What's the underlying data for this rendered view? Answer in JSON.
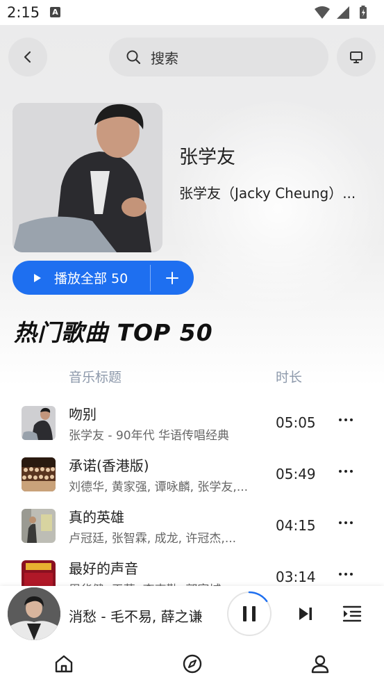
{
  "status_bar": {
    "time": "2:15",
    "notification_letter": "A"
  },
  "search": {
    "label": "搜索"
  },
  "artist": {
    "name": "张学友",
    "alias": "张学友（Jacky Cheung）..."
  },
  "play_all": {
    "label": "播放全部 50"
  },
  "section": {
    "title": "热门歌曲 TOP 50"
  },
  "columns": {
    "title": "音乐标题",
    "duration": "时长"
  },
  "songs": [
    {
      "title": "吻别",
      "subtitle": "张学友 - 90年代 华语传唱经典",
      "duration": "05:05"
    },
    {
      "title": "承诺(香港版)",
      "subtitle": "刘德华, 黄家强, 谭咏麟, 张学友,...",
      "duration": "05:49"
    },
    {
      "title": "真的英雄",
      "subtitle": "卢冠廷, 张智霖, 成龙, 许冠杰,...",
      "duration": "04:15"
    },
    {
      "title": "最好的声音",
      "subtitle": "周华健, 王菲, 李克勤, 郭富城,...",
      "duration": "03:14"
    }
  ],
  "now_playing": {
    "title": "消愁 - 毛不易, 薛之谦",
    "progress": 0.15
  },
  "colors": {
    "accent": "#1e6ff0",
    "header_gray": "#8d99ab"
  },
  "icons": [
    "back-arrow-icon",
    "search-icon",
    "cast-screen-icon",
    "play-icon",
    "plus-icon",
    "more-dots-icon",
    "pause-icon",
    "skip-next-icon",
    "playlist-queue-icon",
    "home-icon",
    "compass-icon",
    "person-icon"
  ]
}
